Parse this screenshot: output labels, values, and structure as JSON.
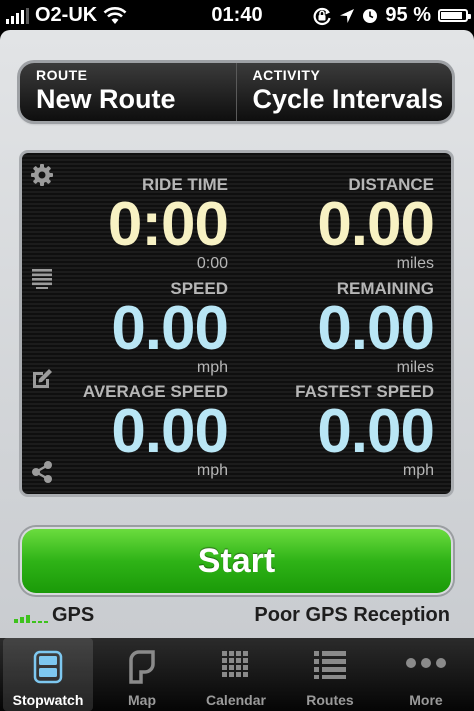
{
  "status_bar": {
    "carrier": "O2-UK",
    "time": "01:40",
    "battery": "95 %",
    "battery_level": 0.95
  },
  "header": {
    "route_label": "ROUTE",
    "route_value": "New Route",
    "activity_label": "ACTIVITY",
    "activity_value": "Cycle Intervals"
  },
  "stats": {
    "ride_time": {
      "label": "RIDE TIME",
      "value": "0:00",
      "sub": "0:00"
    },
    "distance": {
      "label": "DISTANCE",
      "value": "0.00",
      "unit": "miles"
    },
    "speed": {
      "label": "SPEED",
      "value": "0.00",
      "unit": "mph"
    },
    "remaining": {
      "label": "REMAINING",
      "value": "0.00",
      "unit": "miles"
    },
    "average_speed": {
      "label": "AVERAGE SPEED",
      "value": "0.00",
      "unit": "mph"
    },
    "fastest_speed": {
      "label": "FASTEST SPEED",
      "value": "0.00",
      "unit": "mph"
    }
  },
  "start_label": "Start",
  "gps": {
    "label": "GPS",
    "status": "Poor GPS Reception",
    "strength": 0.25
  },
  "tabs": [
    {
      "label": "Stopwatch",
      "icon": "stopwatch-icon",
      "active": true
    },
    {
      "label": "Map",
      "icon": "map-icon",
      "active": false
    },
    {
      "label": "Calendar",
      "icon": "calendar-icon",
      "active": false
    },
    {
      "label": "Routes",
      "icon": "routes-icon",
      "active": false
    },
    {
      "label": "More",
      "icon": "more-icon",
      "active": false
    }
  ],
  "colors": {
    "primary_value": "#f7f1c3",
    "secondary_value": "#b9e6f5",
    "start_button": "#2fb317",
    "gps_good_bar": "#3ec21d"
  }
}
